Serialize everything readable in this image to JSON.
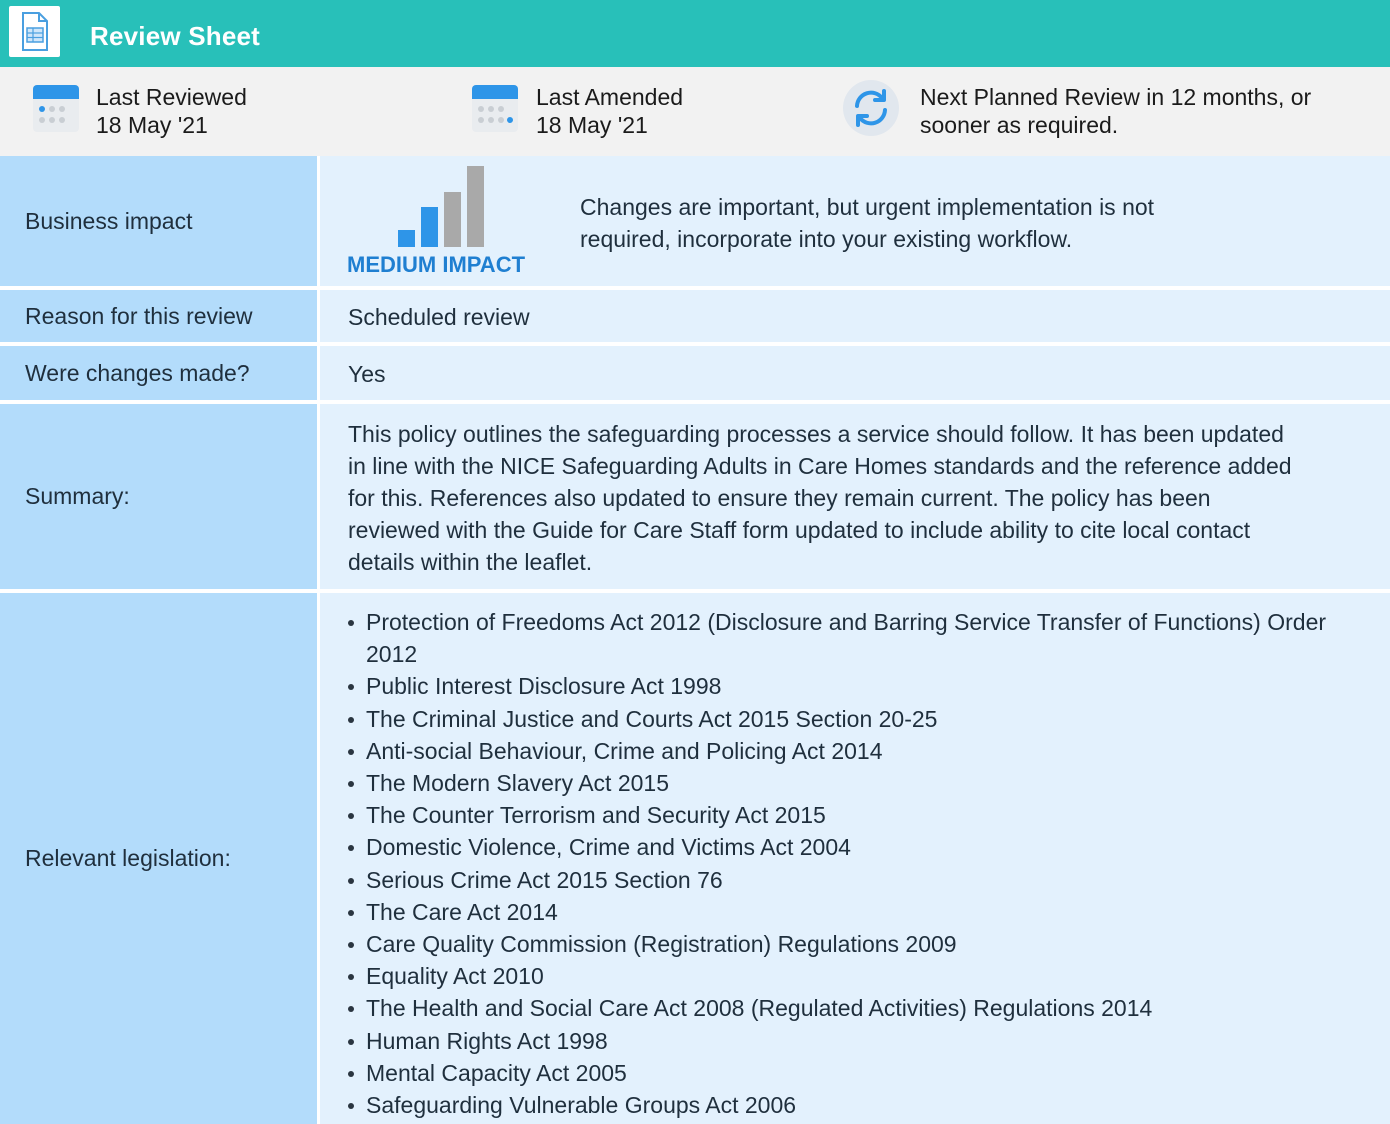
{
  "header": {
    "title": "Review Sheet",
    "icon": "spreadsheet-document-icon"
  },
  "meta": {
    "last_reviewed": {
      "label": "Last Reviewed",
      "date": "18 May '21",
      "icon": "calendar-icon"
    },
    "last_amended": {
      "label": "Last Amended",
      "date": "18 May '21",
      "icon": "calendar-icon"
    },
    "next_review": {
      "line1": "Next Planned Review in 12 months, or",
      "line2": "sooner as required.",
      "icon": "refresh-icon"
    }
  },
  "rows": {
    "business_impact": {
      "label": "Business impact",
      "impact_level": "MEDIUM IMPACT",
      "impact_bars_filled": 2,
      "impact_bars_total": 4,
      "description_line1": "Changes are important, but urgent implementation is not",
      "description_line2": "required, incorporate into your existing workflow."
    },
    "reason": {
      "label": "Reason for this review",
      "value": "Scheduled review"
    },
    "changes": {
      "label": "Were changes made?",
      "value": "Yes"
    },
    "summary": {
      "label": "Summary:",
      "lines": [
        "This policy outlines the safeguarding processes a service should follow. It has been updated",
        "in line with the NICE Safeguarding Adults in Care Homes standards and the reference added",
        "for this. References also updated to ensure they remain current. The policy has been",
        "reviewed with the Guide for Care Staff form updated to include ability to cite local contact",
        "details within the leaflet."
      ]
    },
    "legislation": {
      "label": "Relevant legislation:",
      "items": [
        "Protection of Freedoms Act 2012 (Disclosure and Barring Service Transfer of Functions) Order 2012",
        "Public Interest Disclosure Act 1998",
        "The Criminal Justice and Courts Act 2015 Section 20-25",
        "Anti-social Behaviour, Crime and Policing Act 2014",
        "The Modern Slavery Act 2015",
        "The Counter Terrorism and Security Act 2015",
        "Domestic Violence, Crime and Victims Act 2004",
        "Serious Crime Act 2015 Section 76",
        "The Care Act 2014",
        "Care Quality Commission (Registration) Regulations 2009",
        "Equality Act 2010",
        "The Health and Social Care Act 2008 (Regulated Activities) Regulations 2014",
        "Human Rights Act 1998",
        "Mental Capacity Act 2005",
        "Safeguarding Vulnerable Groups Act 2006"
      ]
    }
  },
  "colors": {
    "header_bg": "#28c0b9",
    "label_bg": "#b3dcfb",
    "value_bg": "#e3f1fd",
    "impact_accent": "#1f7fd1",
    "impact_inactive": "#a9a9a9"
  }
}
